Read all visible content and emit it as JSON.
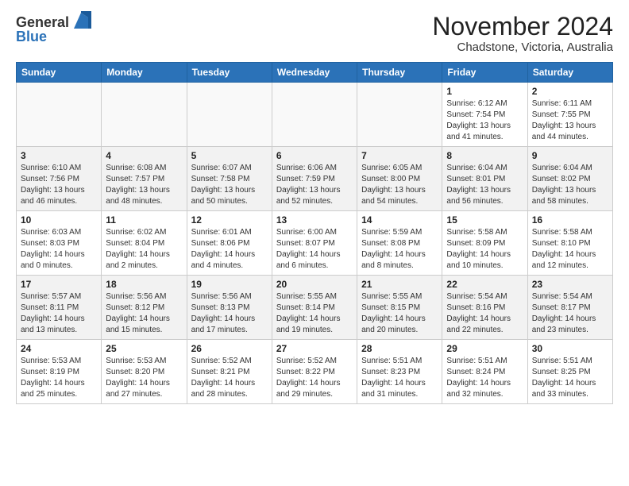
{
  "logo": {
    "line1": "General",
    "line2": "Blue"
  },
  "header": {
    "month": "November 2024",
    "location": "Chadstone, Victoria, Australia"
  },
  "weekdays": [
    "Sunday",
    "Monday",
    "Tuesday",
    "Wednesday",
    "Thursday",
    "Friday",
    "Saturday"
  ],
  "weeks": [
    [
      {
        "day": "",
        "info": ""
      },
      {
        "day": "",
        "info": ""
      },
      {
        "day": "",
        "info": ""
      },
      {
        "day": "",
        "info": ""
      },
      {
        "day": "",
        "info": ""
      },
      {
        "day": "1",
        "info": "Sunrise: 6:12 AM\nSunset: 7:54 PM\nDaylight: 13 hours\nand 41 minutes."
      },
      {
        "day": "2",
        "info": "Sunrise: 6:11 AM\nSunset: 7:55 PM\nDaylight: 13 hours\nand 44 minutes."
      }
    ],
    [
      {
        "day": "3",
        "info": "Sunrise: 6:10 AM\nSunset: 7:56 PM\nDaylight: 13 hours\nand 46 minutes."
      },
      {
        "day": "4",
        "info": "Sunrise: 6:08 AM\nSunset: 7:57 PM\nDaylight: 13 hours\nand 48 minutes."
      },
      {
        "day": "5",
        "info": "Sunrise: 6:07 AM\nSunset: 7:58 PM\nDaylight: 13 hours\nand 50 minutes."
      },
      {
        "day": "6",
        "info": "Sunrise: 6:06 AM\nSunset: 7:59 PM\nDaylight: 13 hours\nand 52 minutes."
      },
      {
        "day": "7",
        "info": "Sunrise: 6:05 AM\nSunset: 8:00 PM\nDaylight: 13 hours\nand 54 minutes."
      },
      {
        "day": "8",
        "info": "Sunrise: 6:04 AM\nSunset: 8:01 PM\nDaylight: 13 hours\nand 56 minutes."
      },
      {
        "day": "9",
        "info": "Sunrise: 6:04 AM\nSunset: 8:02 PM\nDaylight: 13 hours\nand 58 minutes."
      }
    ],
    [
      {
        "day": "10",
        "info": "Sunrise: 6:03 AM\nSunset: 8:03 PM\nDaylight: 14 hours\nand 0 minutes."
      },
      {
        "day": "11",
        "info": "Sunrise: 6:02 AM\nSunset: 8:04 PM\nDaylight: 14 hours\nand 2 minutes."
      },
      {
        "day": "12",
        "info": "Sunrise: 6:01 AM\nSunset: 8:06 PM\nDaylight: 14 hours\nand 4 minutes."
      },
      {
        "day": "13",
        "info": "Sunrise: 6:00 AM\nSunset: 8:07 PM\nDaylight: 14 hours\nand 6 minutes."
      },
      {
        "day": "14",
        "info": "Sunrise: 5:59 AM\nSunset: 8:08 PM\nDaylight: 14 hours\nand 8 minutes."
      },
      {
        "day": "15",
        "info": "Sunrise: 5:58 AM\nSunset: 8:09 PM\nDaylight: 14 hours\nand 10 minutes."
      },
      {
        "day": "16",
        "info": "Sunrise: 5:58 AM\nSunset: 8:10 PM\nDaylight: 14 hours\nand 12 minutes."
      }
    ],
    [
      {
        "day": "17",
        "info": "Sunrise: 5:57 AM\nSunset: 8:11 PM\nDaylight: 14 hours\nand 13 minutes."
      },
      {
        "day": "18",
        "info": "Sunrise: 5:56 AM\nSunset: 8:12 PM\nDaylight: 14 hours\nand 15 minutes."
      },
      {
        "day": "19",
        "info": "Sunrise: 5:56 AM\nSunset: 8:13 PM\nDaylight: 14 hours\nand 17 minutes."
      },
      {
        "day": "20",
        "info": "Sunrise: 5:55 AM\nSunset: 8:14 PM\nDaylight: 14 hours\nand 19 minutes."
      },
      {
        "day": "21",
        "info": "Sunrise: 5:55 AM\nSunset: 8:15 PM\nDaylight: 14 hours\nand 20 minutes."
      },
      {
        "day": "22",
        "info": "Sunrise: 5:54 AM\nSunset: 8:16 PM\nDaylight: 14 hours\nand 22 minutes."
      },
      {
        "day": "23",
        "info": "Sunrise: 5:54 AM\nSunset: 8:17 PM\nDaylight: 14 hours\nand 23 minutes."
      }
    ],
    [
      {
        "day": "24",
        "info": "Sunrise: 5:53 AM\nSunset: 8:19 PM\nDaylight: 14 hours\nand 25 minutes."
      },
      {
        "day": "25",
        "info": "Sunrise: 5:53 AM\nSunset: 8:20 PM\nDaylight: 14 hours\nand 27 minutes."
      },
      {
        "day": "26",
        "info": "Sunrise: 5:52 AM\nSunset: 8:21 PM\nDaylight: 14 hours\nand 28 minutes."
      },
      {
        "day": "27",
        "info": "Sunrise: 5:52 AM\nSunset: 8:22 PM\nDaylight: 14 hours\nand 29 minutes."
      },
      {
        "day": "28",
        "info": "Sunrise: 5:51 AM\nSunset: 8:23 PM\nDaylight: 14 hours\nand 31 minutes."
      },
      {
        "day": "29",
        "info": "Sunrise: 5:51 AM\nSunset: 8:24 PM\nDaylight: 14 hours\nand 32 minutes."
      },
      {
        "day": "30",
        "info": "Sunrise: 5:51 AM\nSunset: 8:25 PM\nDaylight: 14 hours\nand 33 minutes."
      }
    ]
  ]
}
